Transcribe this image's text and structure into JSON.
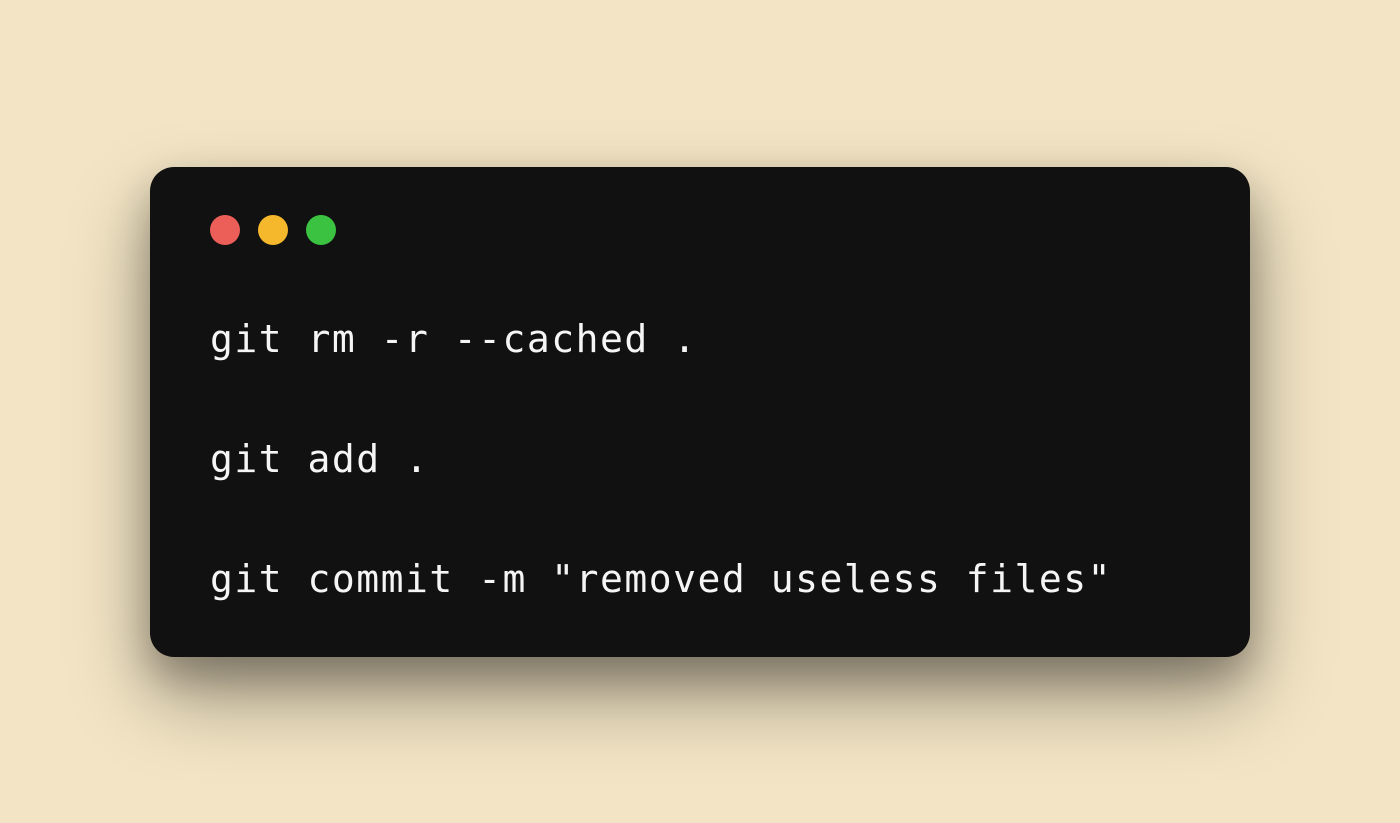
{
  "window": {
    "traffic_lights": {
      "red": "#ec5e58",
      "yellow": "#f5b72c",
      "green": "#3bc241"
    }
  },
  "terminal": {
    "lines": [
      "git rm -r --cached .",
      "git add .",
      "git commit -m \"removed useless files\""
    ]
  }
}
